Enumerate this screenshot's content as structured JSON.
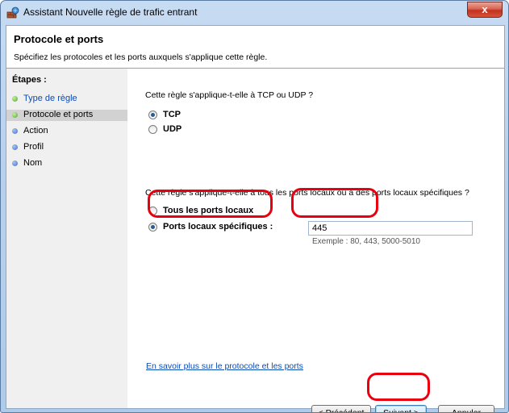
{
  "window": {
    "title": "Assistant Nouvelle règle de trafic entrant",
    "close_label": "x"
  },
  "header": {
    "title": "Protocole et ports",
    "subtitle": "Spécifiez les protocoles et les ports auxquels s'applique cette règle."
  },
  "sidebar": {
    "title": "Étapes :",
    "steps": [
      {
        "label": "Type de règle",
        "state": "done-link"
      },
      {
        "label": "Protocole et ports",
        "state": "active"
      },
      {
        "label": "Action",
        "state": "pending"
      },
      {
        "label": "Profil",
        "state": "pending"
      },
      {
        "label": "Nom",
        "state": "pending"
      }
    ]
  },
  "protocol": {
    "question": "Cette règle s'applique-t-elle à TCP ou UDP ?",
    "options": [
      {
        "label": "TCP",
        "checked": true
      },
      {
        "label": "UDP",
        "checked": false
      }
    ]
  },
  "ports": {
    "question": "Cette règle s'applique-t-elle à tous les ports locaux ou à des ports locaux spécifiques ?",
    "options": [
      {
        "label": "Tous les ports locaux",
        "checked": false
      },
      {
        "label": "Ports locaux spécifiques :",
        "checked": true
      }
    ],
    "value": "445",
    "example": "Exemple : 80, 443, 5000-5010"
  },
  "learn_more": "En savoir plus sur le protocole et les ports",
  "buttons": {
    "back": "< Précédent",
    "next": "Suivant >",
    "cancel": "Annuler"
  },
  "colors": {
    "highlight": "#e8000e",
    "link": "#0b4bb6"
  }
}
